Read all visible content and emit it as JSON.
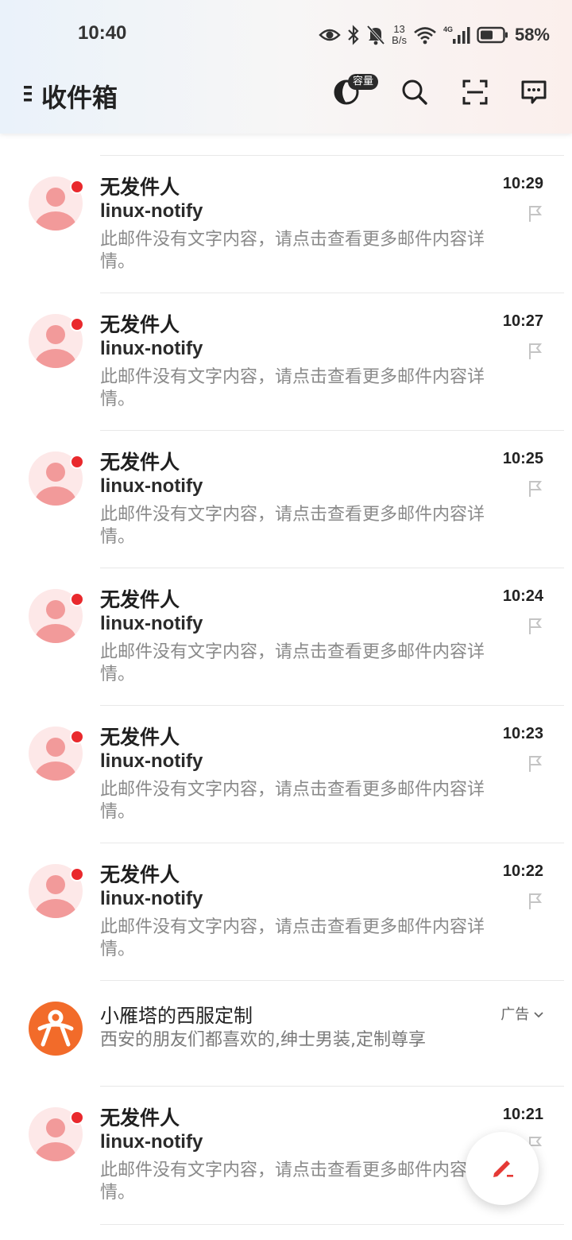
{
  "status_bar": {
    "time": "10:40",
    "net_speed_value": "13",
    "net_speed_unit": "B/s",
    "signal_label": "4G",
    "battery_percent": "58%",
    "battery_level": 0.58
  },
  "header": {
    "title": "收件箱",
    "storage_badge": "容量"
  },
  "inbox": {
    "mails": [
      {
        "sender": "无发件人",
        "subject": "linux-notify",
        "time": "10:29",
        "preview_line1": "此邮件没有文字内容，请点击查看更多邮件内容详",
        "preview_line2": "情。"
      },
      {
        "sender": "无发件人",
        "subject": "linux-notify",
        "time": "10:27",
        "preview_line1": "此邮件没有文字内容，请点击查看更多邮件内容详",
        "preview_line2": "情。"
      },
      {
        "sender": "无发件人",
        "subject": "linux-notify",
        "time": "10:25",
        "preview_line1": "此邮件没有文字内容，请点击查看更多邮件内容详",
        "preview_line2": "情。"
      },
      {
        "sender": "无发件人",
        "subject": "linux-notify",
        "time": "10:24",
        "preview_line1": "此邮件没有文字内容，请点击查看更多邮件内容详",
        "preview_line2": "情。"
      },
      {
        "sender": "无发件人",
        "subject": "linux-notify",
        "time": "10:23",
        "preview_line1": "此邮件没有文字内容，请点击查看更多邮件内容详",
        "preview_line2": "情。"
      },
      {
        "sender": "无发件人",
        "subject": "linux-notify",
        "time": "10:22",
        "preview_line1": "此邮件没有文字内容，请点击查看更多邮件内容详",
        "preview_line2": "情。"
      },
      {
        "sender": "无发件人",
        "subject": "linux-notify",
        "time": "10:21",
        "preview_line1": "此邮件没有文字内容，请点击查看更多邮件内容详",
        "preview_line2": "情。"
      }
    ],
    "ad": {
      "title": "小雁塔的西服定制",
      "description": "西安的朋友们都喜欢的,绅士男装,定制尊享",
      "tag": "广告"
    }
  },
  "colors": {
    "unread_dot": "#e9292d",
    "avatar_bg": "#fde8e8",
    "avatar_fg": "#f29a9a",
    "ad_avatar": "#f26b2a",
    "compose_icon": "#e53935"
  }
}
